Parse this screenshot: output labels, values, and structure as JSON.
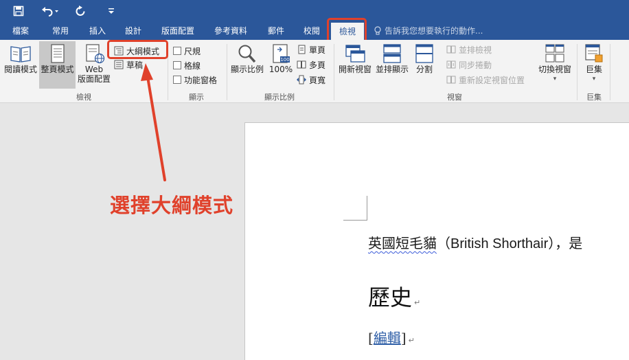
{
  "quick_access": {
    "save_icon": "save-icon",
    "undo_icon": "undo-icon",
    "redo_icon": "redo-icon",
    "customize_icon": "customize-icon"
  },
  "tabs": [
    {
      "label": "檔案"
    },
    {
      "label": "常用"
    },
    {
      "label": "插入"
    },
    {
      "label": "設計"
    },
    {
      "label": "版面配置"
    },
    {
      "label": "參考資料"
    },
    {
      "label": "郵件"
    },
    {
      "label": "校閱"
    },
    {
      "label": "檢視",
      "active": true
    }
  ],
  "tell_me": "告訴我您想要執行的動作...",
  "ribbon": {
    "views": {
      "read_mode": "閱讀模式",
      "print_layout": "整頁模式",
      "web_layout_1": "Web",
      "web_layout_2": "版面配置",
      "outline": "大綱模式",
      "draft": "草稿",
      "label": "檢視"
    },
    "show": {
      "ruler": "尺規",
      "gridlines": "格線",
      "nav_pane": "功能窗格",
      "label": "顯示"
    },
    "zoom": {
      "zoom": "顯示比例",
      "hundred": "100%",
      "one_page": "單頁",
      "multiple_pages": "多頁",
      "page_width": "頁寬",
      "label": "顯示比例"
    },
    "window": {
      "new_window": "開新視窗",
      "arrange_all": "並排顯示",
      "split": "分割",
      "side_by_side": "並排檢視",
      "sync_scroll": "同步捲動",
      "reset_pos": "重新設定視窗位置",
      "switch_windows": "切換視窗",
      "label": "視窗"
    },
    "macros": {
      "macros": "巨集",
      "label": "巨集"
    }
  },
  "annotation": {
    "text": "選擇大綱模式",
    "color": "#e0412b"
  },
  "document": {
    "line1_cjk": "英國短毛貓",
    "line1_latin": "（British Shorthair），是",
    "heading": "歷史",
    "edit_open": "[",
    "edit_link": "編輯",
    "edit_close": "]"
  },
  "colors": {
    "title_bar": "#2b579a",
    "ribbon_bg": "#f3f3f3",
    "workspace_bg": "#e6e6e6"
  }
}
